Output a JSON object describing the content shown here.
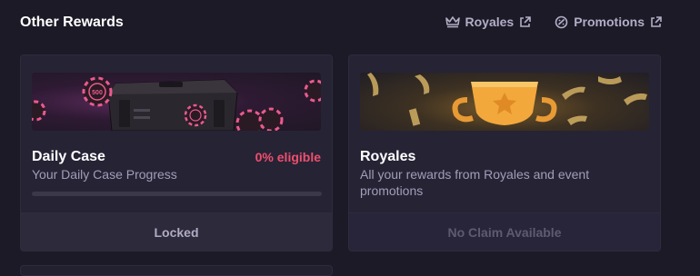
{
  "header": {
    "title": "Other Rewards",
    "links": [
      {
        "label": "Royales",
        "icon": "crown-icon"
      },
      {
        "label": "Promotions",
        "icon": "promotion-coin-icon"
      }
    ]
  },
  "cards": [
    {
      "title": "Daily Case",
      "subtitle": "Your Daily Case Progress",
      "eligible": "0% eligible",
      "progress": 0,
      "footer": "Locked",
      "chip_label": "500"
    },
    {
      "title": "Royales",
      "subtitle": "All your rewards from Royales and event promotions",
      "footer": "No Claim Available"
    }
  ],
  "colors": {
    "accent": "#ef4f6e",
    "background": "#1c1a26",
    "card": "#262335"
  }
}
